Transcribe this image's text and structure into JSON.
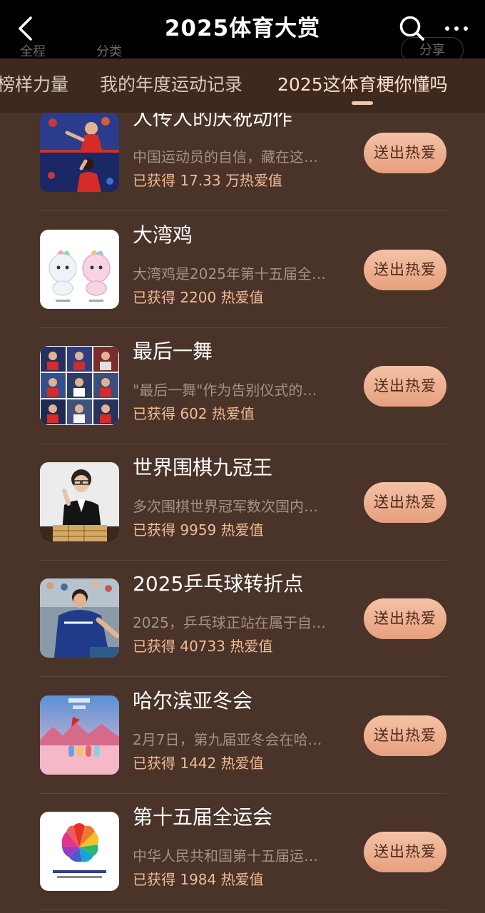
{
  "header": {
    "title": "2025体育大赏",
    "ghost_filters": [
      "全程",
      "分类"
    ],
    "ghost_share": "分享"
  },
  "tabs": [
    {
      "label": "榜样力量",
      "active": false
    },
    {
      "label": "我的年度运动记录",
      "active": false
    },
    {
      "label": "2025这体育梗你懂吗",
      "active": true
    }
  ],
  "accent_colors": {
    "page_background": "#4a3328",
    "tab_bar": "#3e291f",
    "stat_text": "#f0bb95",
    "button": "#eaa988"
  },
  "items": [
    {
      "title": "人传人的庆祝动作",
      "desc": "中国运动员的自信，藏在这…",
      "stat": "已获得 17.33 万热爱值",
      "button": "送出热爱",
      "image": "celebration-photo"
    },
    {
      "title": "大湾鸡",
      "desc": "大湾鸡是2025年第十五届全…",
      "stat": "已获得 2200 热爱值",
      "button": "送出热爱",
      "image": "mascot-illustration"
    },
    {
      "title": "最后一舞",
      "desc": "\"最后一舞\"作为告别仪式的…",
      "stat": "已获得 602 热爱值",
      "button": "送出热爱",
      "image": "athletes-grid-photo"
    },
    {
      "title": "世界围棋九冠王",
      "desc": "多次围棋世界冠军数次国内…",
      "stat": "已获得 9959 热爱值",
      "button": "送出热爱",
      "image": "go-player-photo"
    },
    {
      "title": "2025乒乓球转折点",
      "desc": "2025，乒乓球正站在属于自…",
      "stat": "已获得 40733 热爱值",
      "button": "送出热爱",
      "image": "table-tennis-photo"
    },
    {
      "title": "哈尔滨亚冬会",
      "desc": "2月7日，第九届亚冬会在哈…",
      "stat": "已获得 1442 热爱值",
      "button": "送出热爱",
      "image": "asian-winter-games-poster"
    },
    {
      "title": "第十五届全运会",
      "desc": "中华人民共和国第十五届运…",
      "stat": "已获得 1984 热爱值",
      "button": "送出热爱",
      "image": "national-games-logo"
    }
  ]
}
